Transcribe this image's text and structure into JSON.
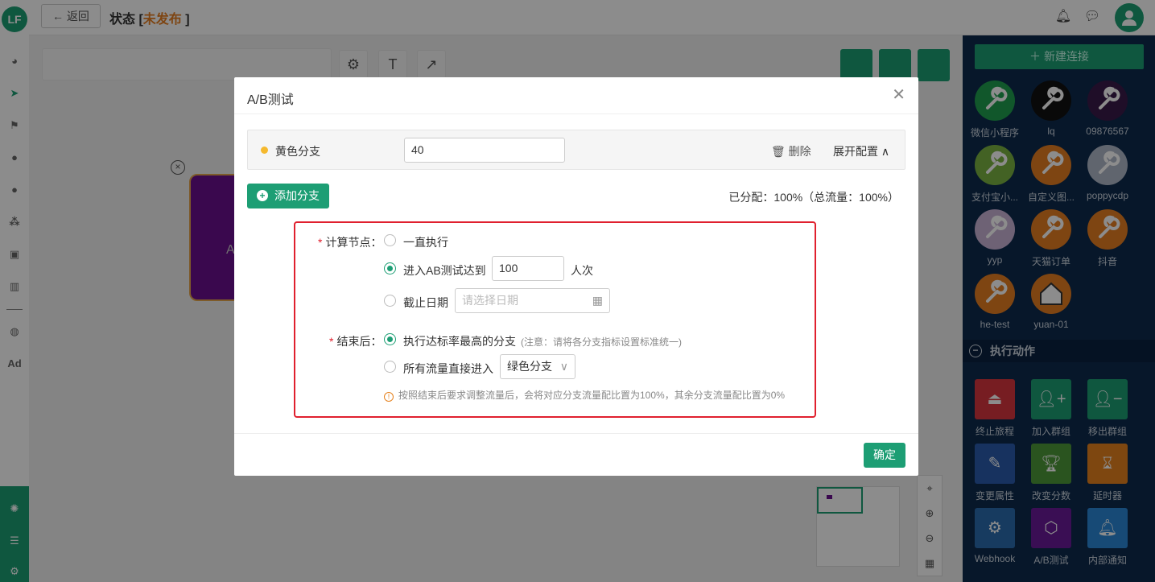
{
  "header": {
    "back_label": "返回",
    "status_prefix": "状态 [",
    "status_value": "未发布",
    "status_suffix": "]",
    "logo_text": "LF"
  },
  "leftnav": {
    "ad_label": "Ad"
  },
  "canvas": {
    "node_letter": "A"
  },
  "right_panel": {
    "new_connection": "新建连接",
    "apps": [
      {
        "label": "微信小程序",
        "color": "#1f9e4f",
        "icon": "mini-program-icon"
      },
      {
        "label": "lq",
        "color": "#111111",
        "icon": "wrench-icon"
      },
      {
        "label": "09876567",
        "color": "#3a1a4a",
        "icon": "wrench-icon"
      },
      {
        "label": "支付宝小...",
        "color": "#7bb342",
        "icon": "wrench-icon"
      },
      {
        "label": "自定义图...",
        "color": "#e67e22",
        "icon": "wrench-icon"
      },
      {
        "label": "poppycdp",
        "color": "#b0b8c8",
        "icon": "wrench-icon"
      },
      {
        "label": "yyp",
        "color": "#c9b2d6",
        "icon": "wrench-icon"
      },
      {
        "label": "天猫订单",
        "color": "#e67e22",
        "icon": "wrench-icon"
      },
      {
        "label": "抖音",
        "color": "#e67e22",
        "icon": "wrench-icon"
      },
      {
        "label": "he-test",
        "color": "#e67e22",
        "icon": "wrench-icon"
      },
      {
        "label": "yuan-01",
        "color": "#e67e22",
        "icon": "house-icon"
      }
    ],
    "actions_title": "执行动作",
    "actions": [
      {
        "label": "终止旅程",
        "color": "#d9363e",
        "icon": "eject-icon"
      },
      {
        "label": "加入群组",
        "color": "#1d9e74",
        "icon": "user-plus-icon"
      },
      {
        "label": "移出群组",
        "color": "#1d9e74",
        "icon": "user-minus-icon"
      },
      {
        "label": "变更属性",
        "color": "#2a5cae",
        "icon": "edit-icon"
      },
      {
        "label": "改变分数",
        "color": "#4e9a3a",
        "icon": "trophy-icon"
      },
      {
        "label": "延时器",
        "color": "#e6821e",
        "icon": "hourglass-icon"
      },
      {
        "label": "Webhook",
        "color": "#2a6cb0",
        "icon": "webhook-icon"
      },
      {
        "label": "A/B测试",
        "color": "#6a1b9a",
        "icon": "ab-test-icon"
      },
      {
        "label": "内部通知",
        "color": "#2b88d8",
        "icon": "bell-icon"
      }
    ]
  },
  "modal": {
    "title": "A/B测试",
    "branch": {
      "name": "黄色分支",
      "value": "40",
      "delete_label": "删除",
      "expand_label": "展开配置",
      "dot_color": "#f5b92e"
    },
    "add_branch_label": "添加分支",
    "allocation_text": "已分配：100%（总流量：100%）",
    "calc_node": {
      "label": "计算节点：",
      "option_always": "一直执行",
      "option_reach": "进入AB测试达到",
      "reach_value": "100",
      "reach_unit": "人次",
      "option_deadline": "截止日期",
      "date_placeholder": "请选择日期",
      "selected": "reach"
    },
    "after_end": {
      "label": "结束后：",
      "option_best": "执行达标率最高的分支",
      "best_note": "(注意：请将各分支指标设置标准统一)",
      "option_all": "所有流量直接进入",
      "branch_select": "绿色分支",
      "selected": "best"
    },
    "tip": "按照结束后要求调整流量后，会将对应分支流量配比置为100%，其余分支流量配比置为0%",
    "ok_label": "确定"
  },
  "colors": {
    "accent": "#1d9e74",
    "warning": "#e67e22",
    "highlight_border": "#e0202e",
    "panel_bg": "#0d2a4d"
  }
}
